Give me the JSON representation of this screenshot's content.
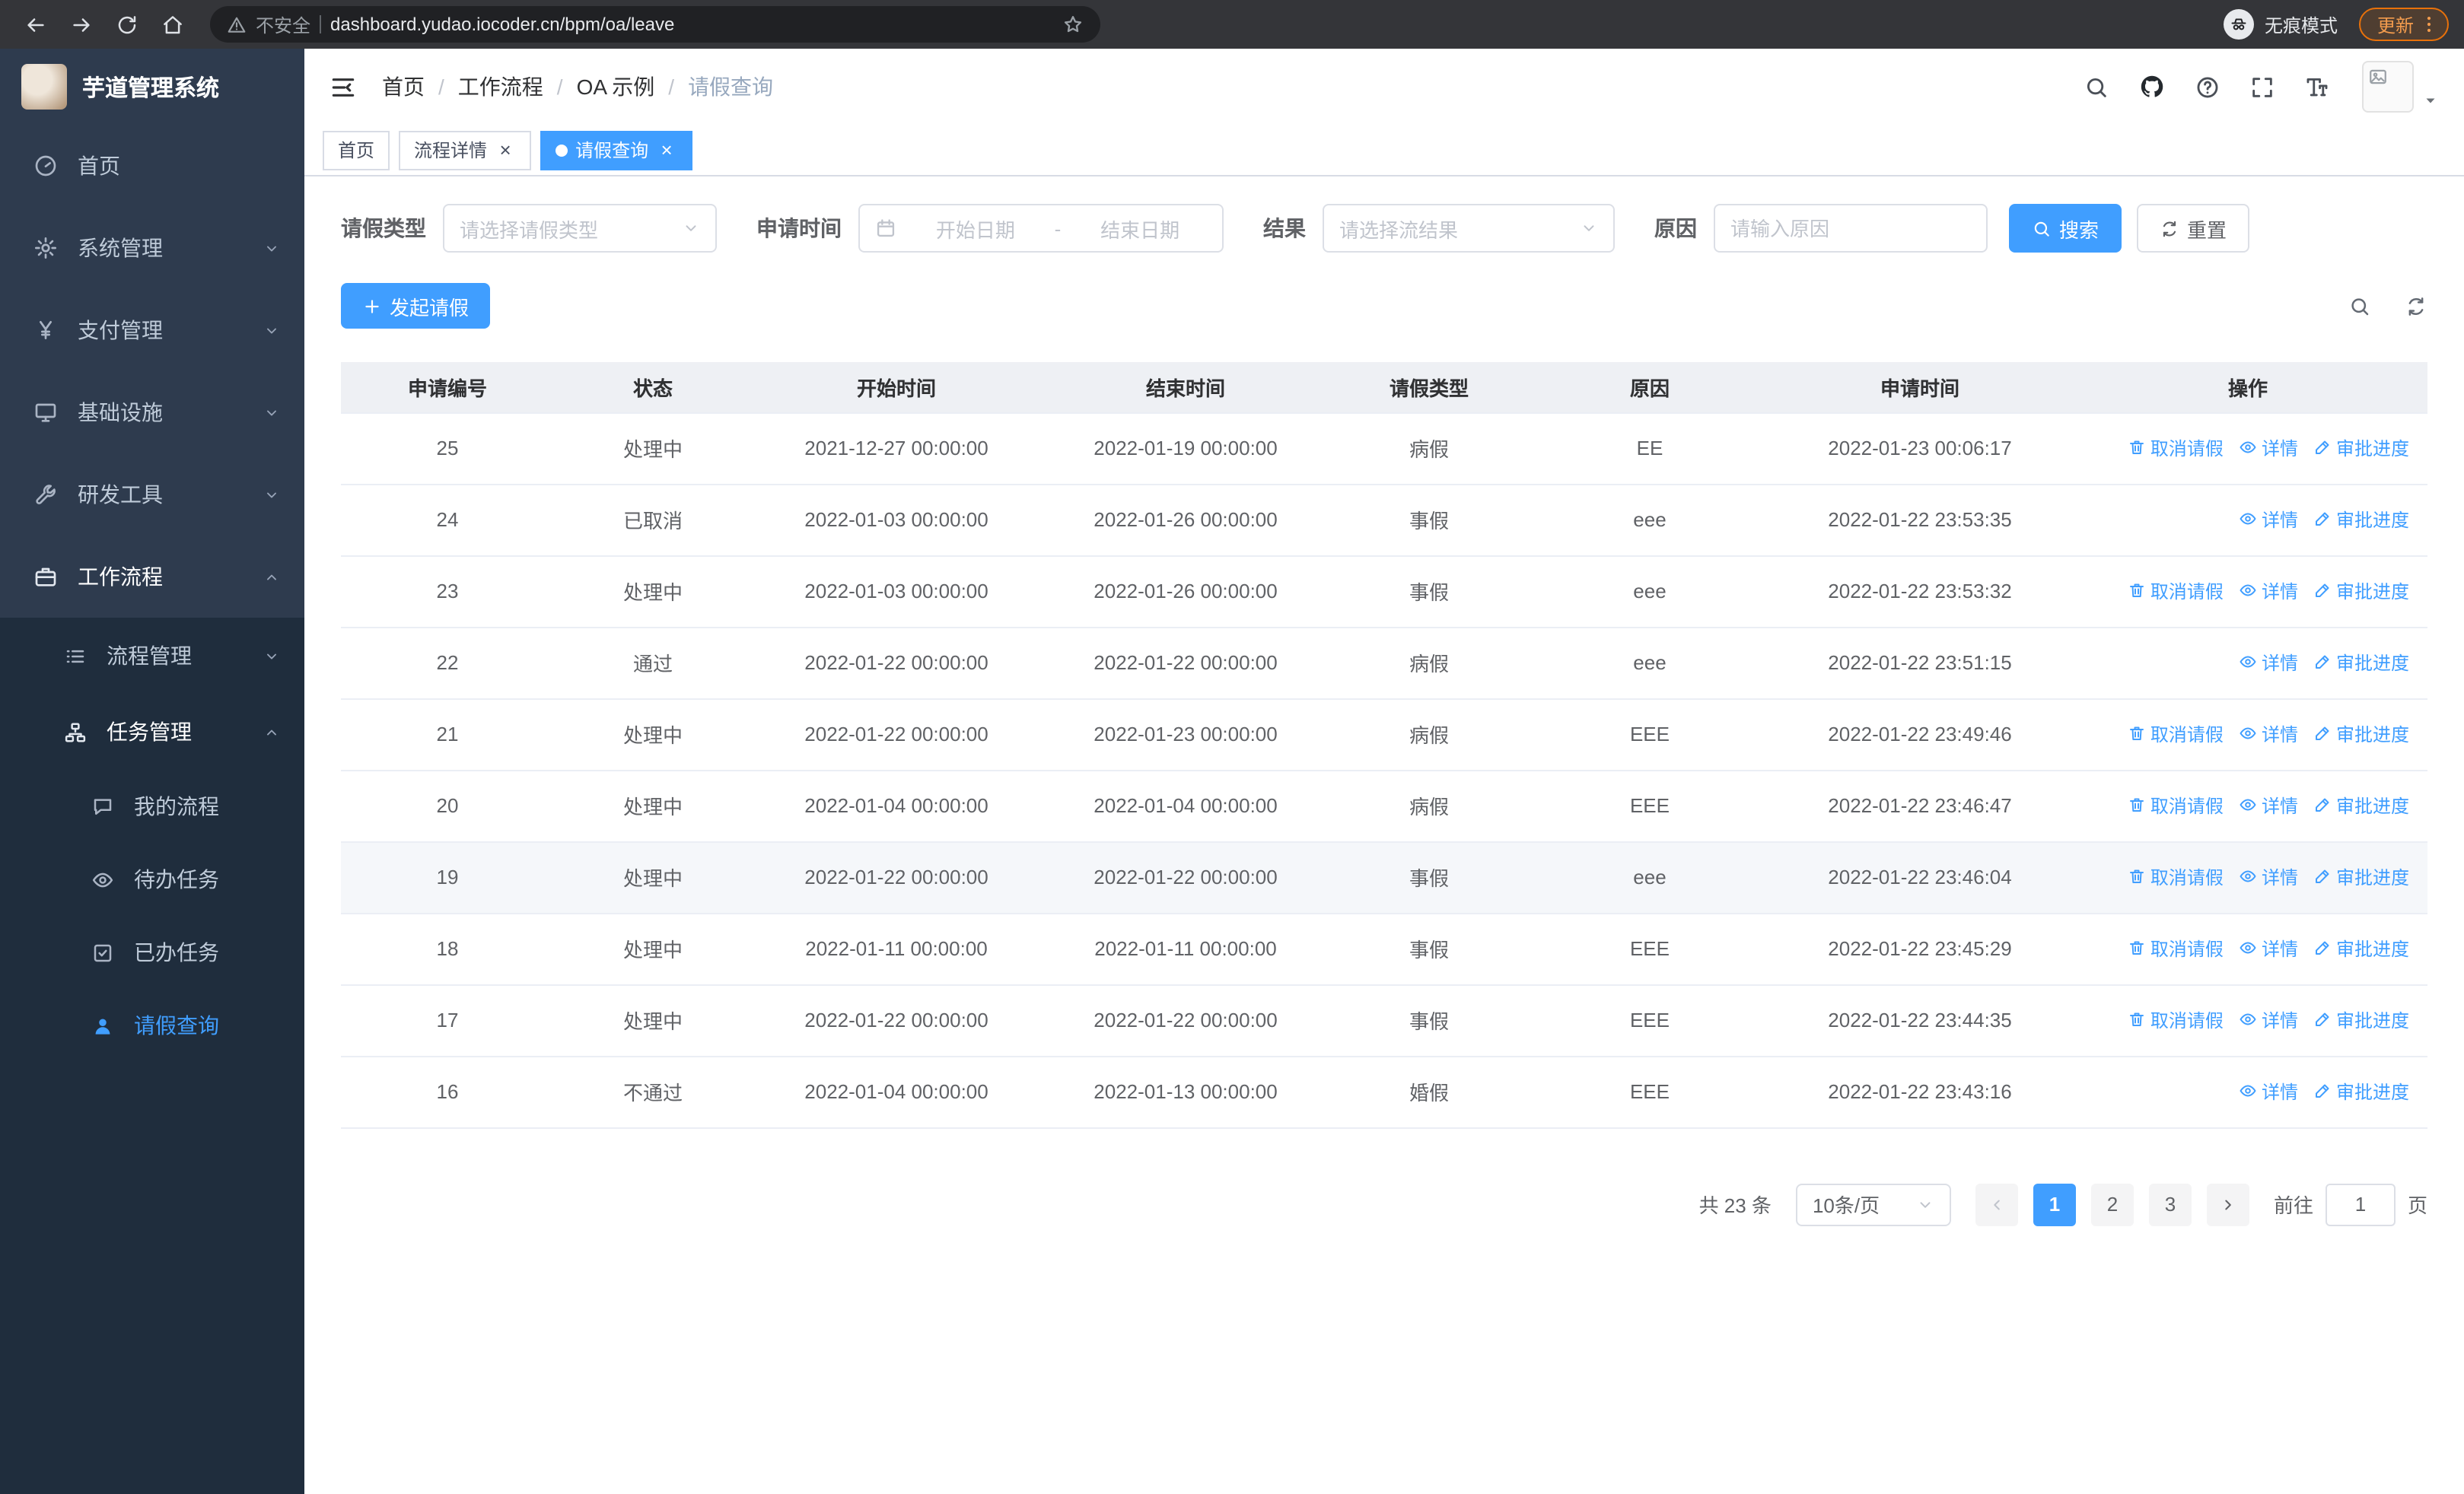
{
  "browser": {
    "warning_label": "不安全",
    "url": "dashboard.yudao.iocoder.cn/bpm/oa/leave",
    "incognito_label": "无痕模式",
    "update_label": "更新"
  },
  "app": {
    "title": "芋道管理系统"
  },
  "sidebar": {
    "menu": [
      {
        "key": "home",
        "label": "首页",
        "icon": "gauge",
        "level": 1
      },
      {
        "key": "system-management",
        "label": "系统管理",
        "icon": "gear",
        "level": 1,
        "chevron": "down"
      },
      {
        "key": "payment-management",
        "label": "支付管理",
        "icon": "yen",
        "level": 1,
        "chevron": "down"
      },
      {
        "key": "infrastructure",
        "label": "基础设施",
        "icon": "monitor",
        "level": 1,
        "chevron": "down"
      },
      {
        "key": "dev-tools",
        "label": "研发工具",
        "icon": "tools",
        "level": 1,
        "chevron": "down"
      },
      {
        "key": "workflow",
        "label": "工作流程",
        "icon": "briefcase",
        "level": 1,
        "chevron": "up",
        "open": true
      }
    ],
    "submenu": [
      {
        "key": "process-management",
        "label": "流程管理",
        "icon": "list",
        "level": 2,
        "chevron": "down"
      },
      {
        "key": "task-management",
        "label": "任务管理",
        "icon": "sitemap",
        "level": 2,
        "chevron": "up",
        "open": true
      },
      {
        "key": "my-process",
        "label": "我的流程",
        "icon": "chat",
        "level": 3
      },
      {
        "key": "todo-tasks",
        "label": "待办任务",
        "icon": "eye",
        "level": 3
      },
      {
        "key": "done-tasks",
        "label": "已办任务",
        "icon": "check-square",
        "level": 3
      },
      {
        "key": "leave-query",
        "label": "请假查询",
        "icon": "user",
        "level": 3,
        "active": true
      }
    ]
  },
  "navbar": {
    "breadcrumb": [
      "首页",
      "工作流程",
      "OA 示例",
      "请假查询"
    ]
  },
  "tabs": [
    {
      "key": "home",
      "label": "首页",
      "closable": false,
      "active": false
    },
    {
      "key": "process-detail",
      "label": "流程详情",
      "closable": true,
      "active": false
    },
    {
      "key": "leave-query",
      "label": "请假查询",
      "closable": true,
      "active": true
    }
  ],
  "filters": {
    "leave_type_label": "请假类型",
    "leave_type_placeholder": "请选择请假类型",
    "apply_time_label": "申请时间",
    "start_date_placeholder": "开始日期",
    "date_separator": "-",
    "end_date_placeholder": "结束日期",
    "result_label": "结果",
    "result_placeholder": "请选择流结果",
    "reason_label": "原因",
    "reason_placeholder": "请输入原因",
    "search_label": "搜索",
    "reset_label": "重置"
  },
  "toolbar": {
    "create_label": "发起请假"
  },
  "table": {
    "columns": [
      "申请编号",
      "状态",
      "开始时间",
      "结束时间",
      "请假类型",
      "原因",
      "申请时间",
      "操作"
    ],
    "action_defs": {
      "cancel": {
        "label": "取消请假",
        "icon": "trash"
      },
      "detail": {
        "label": "详情",
        "icon": "eye"
      },
      "progress": {
        "label": "审批进度",
        "icon": "edit"
      }
    },
    "rows": [
      {
        "id": "25",
        "status": "处理中",
        "start": "2021-12-27 00:00:00",
        "end": "2022-01-19 00:00:00",
        "type": "病假",
        "reason": "EE",
        "applied": "2022-01-23 00:06:17",
        "actions": [
          "cancel",
          "detail",
          "progress"
        ]
      },
      {
        "id": "24",
        "status": "已取消",
        "start": "2022-01-03 00:00:00",
        "end": "2022-01-26 00:00:00",
        "type": "事假",
        "reason": "eee",
        "applied": "2022-01-22 23:53:35",
        "actions": [
          "detail",
          "progress"
        ]
      },
      {
        "id": "23",
        "status": "处理中",
        "start": "2022-01-03 00:00:00",
        "end": "2022-01-26 00:00:00",
        "type": "事假",
        "reason": "eee",
        "applied": "2022-01-22 23:53:32",
        "actions": [
          "cancel",
          "detail",
          "progress"
        ]
      },
      {
        "id": "22",
        "status": "通过",
        "start": "2022-01-22 00:00:00",
        "end": "2022-01-22 00:00:00",
        "type": "病假",
        "reason": "eee",
        "applied": "2022-01-22 23:51:15",
        "actions": [
          "detail",
          "progress"
        ]
      },
      {
        "id": "21",
        "status": "处理中",
        "start": "2022-01-22 00:00:00",
        "end": "2022-01-23 00:00:00",
        "type": "病假",
        "reason": "EEE",
        "applied": "2022-01-22 23:49:46",
        "actions": [
          "cancel",
          "detail",
          "progress"
        ]
      },
      {
        "id": "20",
        "status": "处理中",
        "start": "2022-01-04 00:00:00",
        "end": "2022-01-04 00:00:00",
        "type": "病假",
        "reason": "EEE",
        "applied": "2022-01-22 23:46:47",
        "actions": [
          "cancel",
          "detail",
          "progress"
        ]
      },
      {
        "id": "19",
        "status": "处理中",
        "start": "2022-01-22 00:00:00",
        "end": "2022-01-22 00:00:00",
        "type": "事假",
        "reason": "eee",
        "applied": "2022-01-22 23:46:04",
        "actions": [
          "cancel",
          "detail",
          "progress"
        ],
        "highlighted": true
      },
      {
        "id": "18",
        "status": "处理中",
        "start": "2022-01-11 00:00:00",
        "end": "2022-01-11 00:00:00",
        "type": "事假",
        "reason": "EEE",
        "applied": "2022-01-22 23:45:29",
        "actions": [
          "cancel",
          "detail",
          "progress"
        ]
      },
      {
        "id": "17",
        "status": "处理中",
        "start": "2022-01-22 00:00:00",
        "end": "2022-01-22 00:00:00",
        "type": "事假",
        "reason": "EEE",
        "applied": "2022-01-22 23:44:35",
        "actions": [
          "cancel",
          "detail",
          "progress"
        ]
      },
      {
        "id": "16",
        "status": "不通过",
        "start": "2022-01-04 00:00:00",
        "end": "2022-01-13 00:00:00",
        "type": "婚假",
        "reason": "EEE",
        "applied": "2022-01-22 23:43:16",
        "actions": [
          "detail",
          "progress"
        ]
      }
    ]
  },
  "pagination": {
    "total_label": "共 23 条",
    "page_size_value": "10条/页",
    "pages": [
      "1",
      "2",
      "3"
    ],
    "active_page": "1",
    "goto_label": "前往",
    "goto_value": "1",
    "unit_label": "页"
  },
  "colors": {
    "primary": "#409eff",
    "sidebar": "#2e3b4e",
    "submenu": "#1f2d3d"
  }
}
